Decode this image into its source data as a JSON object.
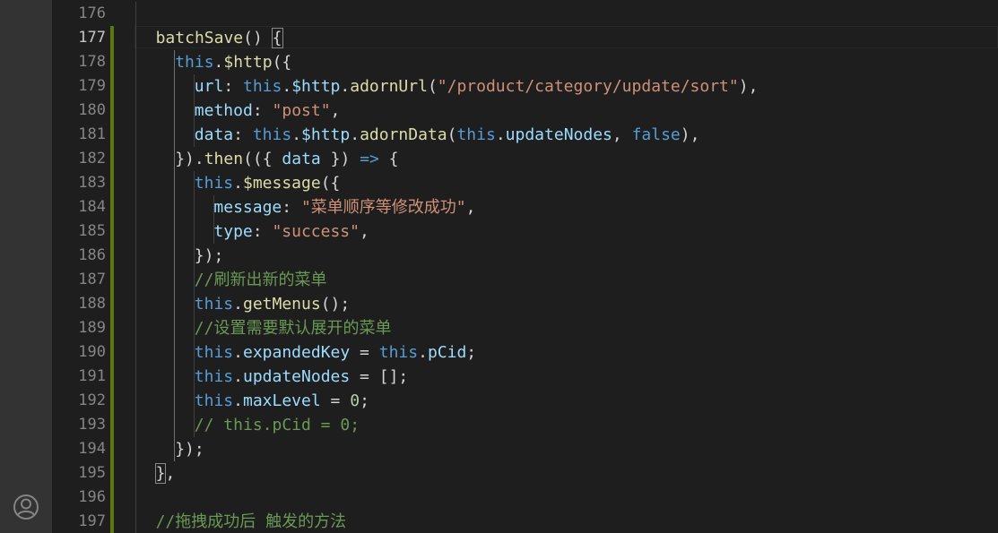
{
  "colors": {
    "gutter_added": "#587c0c",
    "keyword": "#569cd6",
    "function": "#dcdcaa",
    "property": "#9cdcfe",
    "string": "#ce9178",
    "number": "#b5cea8",
    "comment": "#6a9955",
    "plain": "#d4d4d4"
  },
  "activity_bar": {
    "account_icon": "account-icon"
  },
  "editor": {
    "lines": [
      {
        "n": "176",
        "mark": false,
        "indent": 0,
        "tokens": []
      },
      {
        "n": "177",
        "mark": true,
        "indent": 1,
        "tokens": [
          {
            "t": "batchSave",
            "c": "fn"
          },
          {
            "t": "() ",
            "c": "pl"
          },
          {
            "t": "{",
            "c": "pl",
            "hl": true
          }
        ]
      },
      {
        "n": "178",
        "mark": true,
        "indent": 2,
        "tokens": [
          {
            "t": "this",
            "c": "kw"
          },
          {
            "t": ".",
            "c": "pl"
          },
          {
            "t": "$http",
            "c": "fn"
          },
          {
            "t": "({",
            "c": "pl"
          }
        ]
      },
      {
        "n": "179",
        "mark": true,
        "indent": 3,
        "tokens": [
          {
            "t": "url",
            "c": "prop"
          },
          {
            "t": ": ",
            "c": "pl"
          },
          {
            "t": "this",
            "c": "kw"
          },
          {
            "t": ".",
            "c": "pl"
          },
          {
            "t": "$http",
            "c": "prop"
          },
          {
            "t": ".",
            "c": "pl"
          },
          {
            "t": "adornUrl",
            "c": "fn"
          },
          {
            "t": "(",
            "c": "pl"
          },
          {
            "t": "\"/product/category/update/sort\"",
            "c": "str"
          },
          {
            "t": "),",
            "c": "pl"
          }
        ]
      },
      {
        "n": "180",
        "mark": true,
        "indent": 3,
        "tokens": [
          {
            "t": "method",
            "c": "prop"
          },
          {
            "t": ": ",
            "c": "pl"
          },
          {
            "t": "\"post\"",
            "c": "str"
          },
          {
            "t": ",",
            "c": "pl"
          }
        ]
      },
      {
        "n": "181",
        "mark": true,
        "indent": 3,
        "tokens": [
          {
            "t": "data",
            "c": "prop"
          },
          {
            "t": ": ",
            "c": "pl"
          },
          {
            "t": "this",
            "c": "kw"
          },
          {
            "t": ".",
            "c": "pl"
          },
          {
            "t": "$http",
            "c": "prop"
          },
          {
            "t": ".",
            "c": "pl"
          },
          {
            "t": "adornData",
            "c": "fn"
          },
          {
            "t": "(",
            "c": "pl"
          },
          {
            "t": "this",
            "c": "kw"
          },
          {
            "t": ".",
            "c": "pl"
          },
          {
            "t": "updateNodes",
            "c": "prop"
          },
          {
            "t": ", ",
            "c": "pl"
          },
          {
            "t": "false",
            "c": "kw"
          },
          {
            "t": "),",
            "c": "pl"
          }
        ]
      },
      {
        "n": "182",
        "mark": true,
        "indent": 2,
        "tokens": [
          {
            "t": "}).",
            "c": "pl"
          },
          {
            "t": "then",
            "c": "fn"
          },
          {
            "t": "(({ ",
            "c": "pl"
          },
          {
            "t": "data",
            "c": "prop"
          },
          {
            "t": " }) ",
            "c": "pl"
          },
          {
            "t": "=>",
            "c": "kw"
          },
          {
            "t": " {",
            "c": "pl"
          }
        ]
      },
      {
        "n": "183",
        "mark": true,
        "indent": 3,
        "tokens": [
          {
            "t": "this",
            "c": "kw"
          },
          {
            "t": ".",
            "c": "pl"
          },
          {
            "t": "$message",
            "c": "fn"
          },
          {
            "t": "({",
            "c": "pl"
          }
        ]
      },
      {
        "n": "184",
        "mark": true,
        "indent": 4,
        "tokens": [
          {
            "t": "message",
            "c": "prop"
          },
          {
            "t": ": ",
            "c": "pl"
          },
          {
            "t": "\"菜单顺序等修改成功\"",
            "c": "str"
          },
          {
            "t": ",",
            "c": "pl"
          }
        ]
      },
      {
        "n": "185",
        "mark": true,
        "indent": 4,
        "tokens": [
          {
            "t": "type",
            "c": "prop"
          },
          {
            "t": ": ",
            "c": "pl"
          },
          {
            "t": "\"success\"",
            "c": "str"
          },
          {
            "t": ",",
            "c": "pl"
          }
        ]
      },
      {
        "n": "186",
        "mark": true,
        "indent": 3,
        "tokens": [
          {
            "t": "});",
            "c": "pl"
          }
        ]
      },
      {
        "n": "187",
        "mark": true,
        "indent": 3,
        "tokens": [
          {
            "t": "//刷新出新的菜单",
            "c": "cm"
          }
        ]
      },
      {
        "n": "188",
        "mark": true,
        "indent": 3,
        "tokens": [
          {
            "t": "this",
            "c": "kw"
          },
          {
            "t": ".",
            "c": "pl"
          },
          {
            "t": "getMenus",
            "c": "fn"
          },
          {
            "t": "();",
            "c": "pl"
          }
        ]
      },
      {
        "n": "189",
        "mark": true,
        "indent": 3,
        "tokens": [
          {
            "t": "//设置需要默认展开的菜单",
            "c": "cm"
          }
        ]
      },
      {
        "n": "190",
        "mark": true,
        "indent": 3,
        "tokens": [
          {
            "t": "this",
            "c": "kw"
          },
          {
            "t": ".",
            "c": "pl"
          },
          {
            "t": "expandedKey",
            "c": "prop"
          },
          {
            "t": " = ",
            "c": "pl"
          },
          {
            "t": "this",
            "c": "kw"
          },
          {
            "t": ".",
            "c": "pl"
          },
          {
            "t": "pCid",
            "c": "prop"
          },
          {
            "t": ";",
            "c": "pl"
          }
        ]
      },
      {
        "n": "191",
        "mark": true,
        "indent": 3,
        "tokens": [
          {
            "t": "this",
            "c": "kw"
          },
          {
            "t": ".",
            "c": "pl"
          },
          {
            "t": "updateNodes",
            "c": "prop"
          },
          {
            "t": " = [];",
            "c": "pl"
          }
        ]
      },
      {
        "n": "192",
        "mark": true,
        "indent": 3,
        "tokens": [
          {
            "t": "this",
            "c": "kw"
          },
          {
            "t": ".",
            "c": "pl"
          },
          {
            "t": "maxLevel",
            "c": "prop"
          },
          {
            "t": " = ",
            "c": "pl"
          },
          {
            "t": "0",
            "c": "num"
          },
          {
            "t": ";",
            "c": "pl"
          }
        ]
      },
      {
        "n": "193",
        "mark": true,
        "indent": 3,
        "tokens": [
          {
            "t": "// this.pCid = 0;",
            "c": "cm"
          }
        ]
      },
      {
        "n": "194",
        "mark": true,
        "indent": 2,
        "tokens": [
          {
            "t": "});",
            "c": "pl"
          }
        ]
      },
      {
        "n": "195",
        "mark": true,
        "indent": 1,
        "tokens": [
          {
            "t": "}",
            "c": "pl",
            "hl": true
          },
          {
            "t": ",",
            "c": "pl"
          }
        ]
      },
      {
        "n": "196",
        "mark": true,
        "indent": 0,
        "tokens": []
      },
      {
        "n": "197",
        "mark": true,
        "indent": 1,
        "tokens": [
          {
            "t": "//拖拽成功后 触发的方法",
            "c": "cm"
          }
        ]
      }
    ]
  }
}
